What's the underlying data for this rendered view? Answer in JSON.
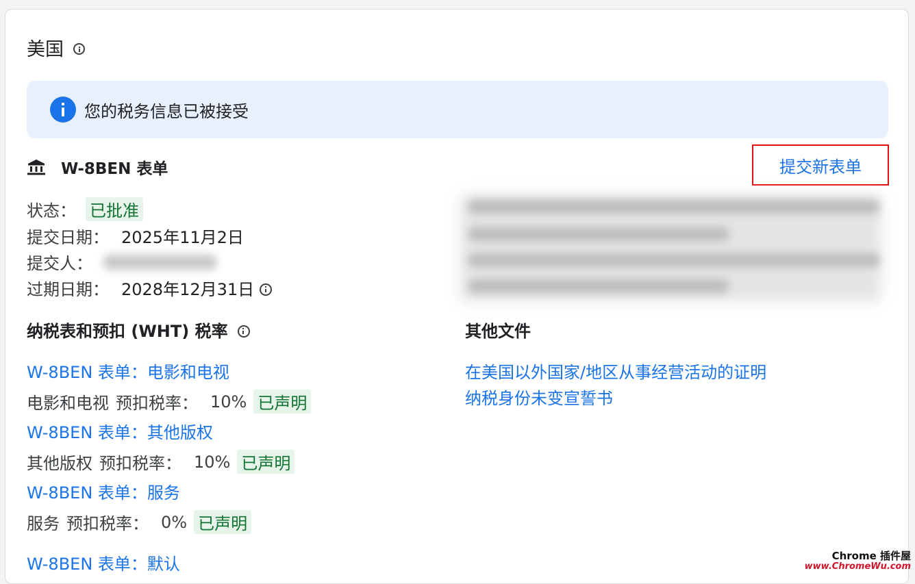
{
  "header": {
    "country": "美国"
  },
  "banner": {
    "message": "您的税务信息已被接受"
  },
  "form": {
    "title": "W-8BEN 表单",
    "submit_label": "提交新表单",
    "status_label": "状态：",
    "status_value": "已批准",
    "submitted_date_label": "提交日期：",
    "submitted_date_value": "2025年11月2日",
    "submitter_label": "提交人：",
    "expiry_label": "过期日期：",
    "expiry_value": "2028年12月31日"
  },
  "withholding": {
    "heading": "纳税表和预扣 (WHT) 税率",
    "items": [
      {
        "link": "W-8BEN 表单：电影和电视",
        "category": "电影和电视",
        "rate_label": "预扣税率：",
        "rate": "10%",
        "badge": "已声明"
      },
      {
        "link": "W-8BEN 表单：其他版权",
        "category": "其他版权",
        "rate_label": "预扣税率：",
        "rate": "10%",
        "badge": "已声明"
      },
      {
        "link": "W-8BEN 表单：服务",
        "category": "服务",
        "rate_label": "预扣税率：",
        "rate": "0%",
        "badge": "已声明"
      },
      {
        "link": "W-8BEN 表单：默认"
      }
    ]
  },
  "other_files": {
    "heading": "其他文件",
    "links": [
      "在美国以外国家/地区从事经营活动的证明",
      "纳税身份未变宣誓书"
    ]
  },
  "watermark": {
    "line1": "Chrome 插件屋",
    "line2": "www.ChromeWu.com"
  },
  "colors": {
    "link": "#1a73e8",
    "badge_bg": "#e6f4ea",
    "badge_text": "#137333",
    "banner_bg": "#e8f0fe",
    "highlight_border": "#e01010"
  }
}
